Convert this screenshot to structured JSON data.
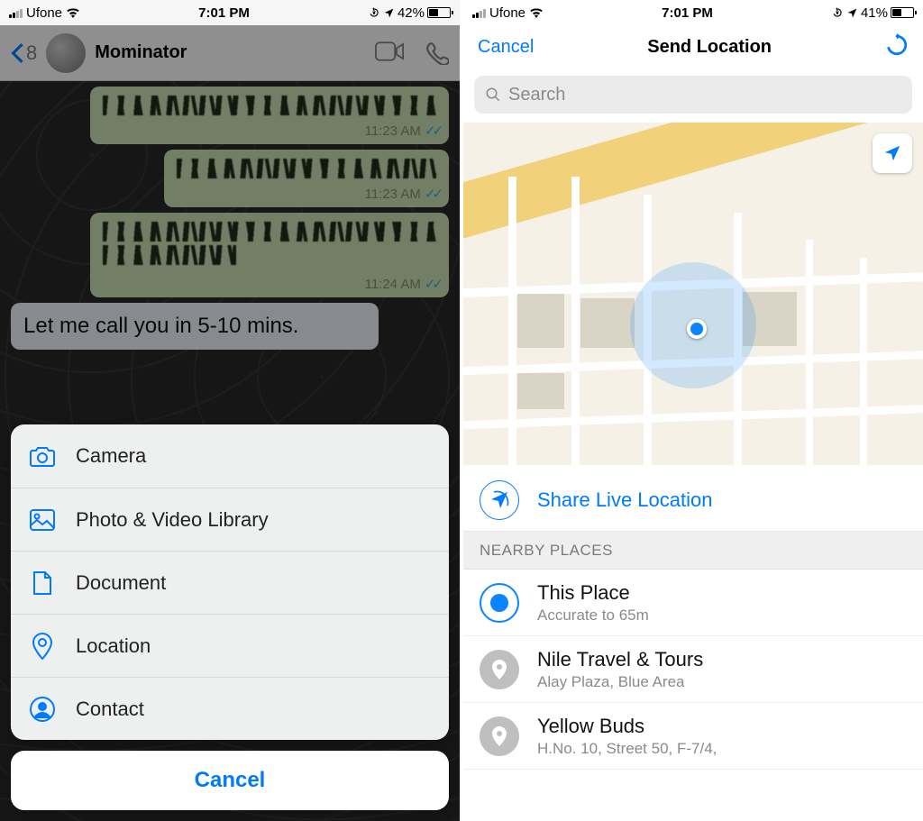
{
  "left": {
    "status": {
      "carrier": "Ufone",
      "time": "7:01 PM",
      "battery_pct": "42%",
      "battery_level": 42
    },
    "header": {
      "back_count": "8",
      "name": "Mominator"
    },
    "messages": {
      "ts1": "11:23 AM",
      "ts2": "11:23 AM",
      "ts3": "11:24 AM",
      "incoming": "Let me call you in 5-10 mins."
    },
    "sheet": {
      "camera": "Camera",
      "photo": "Photo & Video Library",
      "document": "Document",
      "location": "Location",
      "contact": "Contact",
      "cancel": "Cancel"
    }
  },
  "right": {
    "status": {
      "carrier": "Ufone",
      "time": "7:01 PM",
      "battery_pct": "41%",
      "battery_level": 41
    },
    "nav": {
      "cancel": "Cancel",
      "title": "Send Location"
    },
    "search_placeholder": "Search",
    "share_live": "Share Live Location",
    "section": "NEARBY PLACES",
    "places": {
      "p1": {
        "name": "This Place",
        "sub": "Accurate to 65m"
      },
      "p2": {
        "name": "Nile Travel & Tours",
        "sub": "Alay Plaza, Blue Area"
      },
      "p3": {
        "name": "Yellow Buds",
        "sub": "H.No. 10, Street 50, F-7/4,"
      }
    }
  }
}
